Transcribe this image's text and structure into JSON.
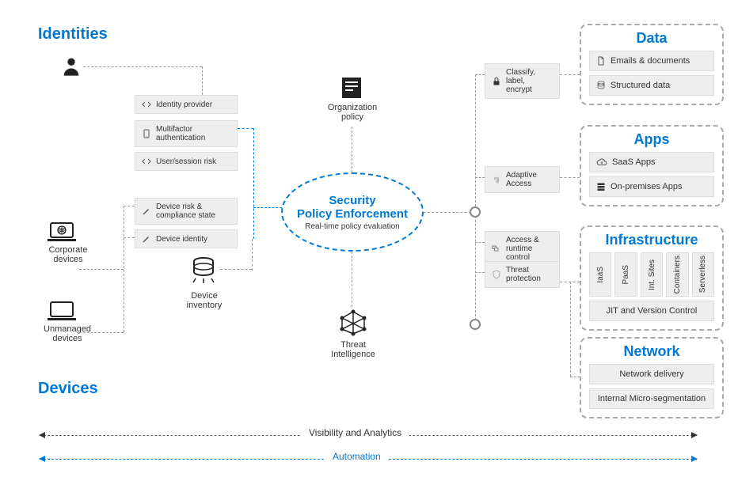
{
  "sections": {
    "identities": "Identities",
    "devices": "Devices"
  },
  "left": {
    "corporate": "Corporate devices",
    "unmanaged": "Unmanaged devices"
  },
  "identityChips": {
    "provider": "Identity  provider",
    "mfa": "Multifactor authentication",
    "risk": "User/session risk"
  },
  "deviceChips": {
    "risk": "Device  risk & compliance  state",
    "identity": "Device identity",
    "inventory": "Device inventory"
  },
  "top": {
    "orgPolicy": "Organization policy"
  },
  "center": {
    "title1": "Security",
    "title2": "Policy  Enforcement",
    "subtitle": "Real-time policy evaluation"
  },
  "bottom": {
    "threat": "Threat Intelligence"
  },
  "rightChips": {
    "classify": "Classify, label, encrypt",
    "adaptive": "Adaptive Access",
    "access": "Access & runtime  control",
    "threatProt": "Threat protection"
  },
  "data": {
    "title": "Data",
    "emails": "Emails & documents",
    "structured": "Structured data"
  },
  "apps": {
    "title": "Apps",
    "saas": "SaaS Apps",
    "onprem": "On-premises Apps"
  },
  "infra": {
    "title": "Infrastructure",
    "iaas": "IaaS",
    "paas": "PaaS",
    "int": "Int. Sites",
    "containers": "Containers",
    "serverless": "Serverless",
    "jit": "JIT and Version Control"
  },
  "network": {
    "title": "Network",
    "delivery": "Network delivery",
    "micro": "Internal Micro-segmentation"
  },
  "footer": {
    "visibility": "Visibility and Analytics",
    "automation": "Automation"
  }
}
